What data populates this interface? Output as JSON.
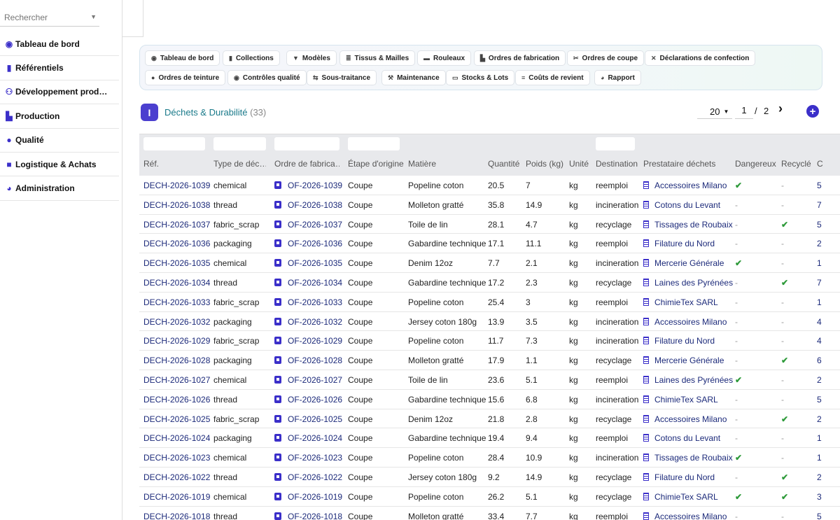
{
  "search": {
    "placeholder": "Rechercher"
  },
  "sidebar": {
    "items": [
      {
        "label": "Tableau de bord",
        "icon": "gauge-icon"
      },
      {
        "label": "Référentiels",
        "icon": "book-icon"
      },
      {
        "label": "Développement prod…",
        "icon": "people-icon"
      },
      {
        "label": "Production",
        "icon": "factory-icon"
      },
      {
        "label": "Qualité",
        "icon": "check-circle-icon"
      },
      {
        "label": "Logistique & Achats",
        "icon": "truck-icon"
      },
      {
        "label": "Administration",
        "icon": "pie-icon"
      }
    ]
  },
  "toolbar": {
    "row1": [
      {
        "label": "Tableau de bord",
        "icon": "gauge-icon"
      },
      {
        "label": "Collections",
        "icon": "book-icon"
      },
      {
        "label": "Modèles",
        "icon": "shirt-icon"
      },
      {
        "label": "Tissus & Mailles",
        "icon": "layers-icon"
      },
      {
        "label": "Rouleaux",
        "icon": "roll-icon"
      },
      {
        "label": "Ordres de fabrication",
        "icon": "factory-icon"
      },
      {
        "label": "Ordres de coupe",
        "icon": "scissors-icon"
      },
      {
        "label": "Déclarations de confection",
        "icon": "tools-icon"
      }
    ],
    "row2": [
      {
        "label": "Ordres de teinture",
        "icon": "drop-icon"
      },
      {
        "label": "Contrôles qualité",
        "icon": "check-circle-icon"
      },
      {
        "label": "Sous-traitance",
        "icon": "handshake-icon"
      },
      {
        "label": "Maintenance",
        "icon": "wrench-icon"
      },
      {
        "label": "Stocks & Lots",
        "icon": "warehouse-icon"
      },
      {
        "label": "Coûts de revient",
        "icon": "coins-icon"
      },
      {
        "label": "Rapport",
        "icon": "chart-pie-icon"
      }
    ]
  },
  "header": {
    "title": "Déchets & Durabilité",
    "count": "(33)",
    "page_size": "20",
    "page": "1",
    "page_sep": "/",
    "total_pages": "2"
  },
  "table": {
    "columns": [
      "Réf.",
      "Type de déc…",
      "Ordre de fabrica…",
      "Étape d'origine",
      "Matière",
      "Quantité",
      "Poids (kg)",
      "Unité",
      "Destination",
      "Prestataire déchets",
      "Dangereux",
      "Recyclé",
      "C"
    ],
    "rows": [
      {
        "ref": "DECH-2026-1039",
        "type": "chemical",
        "of": "OF-2026-1039",
        "etape": "Coupe",
        "matiere": "Popeline coton",
        "quantite": "20.5",
        "poids": "7",
        "unite": "kg",
        "destination": "reemploi",
        "prestataire": "Accessoires Milano",
        "dangereux": true,
        "recycle": false,
        "c": "5"
      },
      {
        "ref": "DECH-2026-1038",
        "type": "thread",
        "of": "OF-2026-1038",
        "etape": "Coupe",
        "matiere": "Molleton gratté",
        "quantite": "35.8",
        "poids": "14.9",
        "unite": "kg",
        "destination": "incineration",
        "prestataire": "Cotons du Levant",
        "dangereux": false,
        "recycle": false,
        "c": "7"
      },
      {
        "ref": "DECH-2026-1037",
        "type": "fabric_scrap",
        "of": "OF-2026-1037",
        "etape": "Coupe",
        "matiere": "Toile de lin",
        "quantite": "28.1",
        "poids": "4.7",
        "unite": "kg",
        "destination": "recyclage",
        "prestataire": "Tissages de Roubaix",
        "dangereux": false,
        "recycle": true,
        "c": "5"
      },
      {
        "ref": "DECH-2026-1036",
        "type": "packaging",
        "of": "OF-2026-1036",
        "etape": "Coupe",
        "matiere": "Gabardine technique",
        "quantite": "17.1",
        "poids": "11.1",
        "unite": "kg",
        "destination": "reemploi",
        "prestataire": "Filature du Nord",
        "dangereux": false,
        "recycle": false,
        "c": "2"
      },
      {
        "ref": "DECH-2026-1035",
        "type": "chemical",
        "of": "OF-2026-1035",
        "etape": "Coupe",
        "matiere": "Denim 12oz",
        "quantite": "7.7",
        "poids": "2.1",
        "unite": "kg",
        "destination": "incineration",
        "prestataire": "Mercerie Générale",
        "dangereux": true,
        "recycle": false,
        "c": "1"
      },
      {
        "ref": "DECH-2026-1034",
        "type": "thread",
        "of": "OF-2026-1034",
        "etape": "Coupe",
        "matiere": "Gabardine technique",
        "quantite": "17.2",
        "poids": "2.3",
        "unite": "kg",
        "destination": "recyclage",
        "prestataire": "Laines des Pyrénées",
        "dangereux": false,
        "recycle": true,
        "c": "7"
      },
      {
        "ref": "DECH-2026-1033",
        "type": "fabric_scrap",
        "of": "OF-2026-1033",
        "etape": "Coupe",
        "matiere": "Popeline coton",
        "quantite": "25.4",
        "poids": "3",
        "unite": "kg",
        "destination": "reemploi",
        "prestataire": "ChimieTex SARL",
        "dangereux": false,
        "recycle": false,
        "c": "1"
      },
      {
        "ref": "DECH-2026-1032",
        "type": "packaging",
        "of": "OF-2026-1032",
        "etape": "Coupe",
        "matiere": "Jersey coton 180g",
        "quantite": "13.9",
        "poids": "3.5",
        "unite": "kg",
        "destination": "incineration",
        "prestataire": "Accessoires Milano",
        "dangereux": false,
        "recycle": false,
        "c": "4"
      },
      {
        "ref": "DECH-2026-1029",
        "type": "fabric_scrap",
        "of": "OF-2026-1029",
        "etape": "Coupe",
        "matiere": "Popeline coton",
        "quantite": "11.7",
        "poids": "7.3",
        "unite": "kg",
        "destination": "incineration",
        "prestataire": "Filature du Nord",
        "dangereux": false,
        "recycle": false,
        "c": "4"
      },
      {
        "ref": "DECH-2026-1028",
        "type": "packaging",
        "of": "OF-2026-1028",
        "etape": "Coupe",
        "matiere": "Molleton gratté",
        "quantite": "17.9",
        "poids": "1.1",
        "unite": "kg",
        "destination": "recyclage",
        "prestataire": "Mercerie Générale",
        "dangereux": false,
        "recycle": true,
        "c": "6"
      },
      {
        "ref": "DECH-2026-1027",
        "type": "chemical",
        "of": "OF-2026-1027",
        "etape": "Coupe",
        "matiere": "Toile de lin",
        "quantite": "23.6",
        "poids": "5.1",
        "unite": "kg",
        "destination": "reemploi",
        "prestataire": "Laines des Pyrénées",
        "dangereux": true,
        "recycle": false,
        "c": "2"
      },
      {
        "ref": "DECH-2026-1026",
        "type": "thread",
        "of": "OF-2026-1026",
        "etape": "Coupe",
        "matiere": "Gabardine technique",
        "quantite": "15.6",
        "poids": "6.8",
        "unite": "kg",
        "destination": "incineration",
        "prestataire": "ChimieTex SARL",
        "dangereux": false,
        "recycle": false,
        "c": "5"
      },
      {
        "ref": "DECH-2026-1025",
        "type": "fabric_scrap",
        "of": "OF-2026-1025",
        "etape": "Coupe",
        "matiere": "Denim 12oz",
        "quantite": "21.8",
        "poids": "2.8",
        "unite": "kg",
        "destination": "recyclage",
        "prestataire": "Accessoires Milano",
        "dangereux": false,
        "recycle": true,
        "c": "2"
      },
      {
        "ref": "DECH-2026-1024",
        "type": "packaging",
        "of": "OF-2026-1024",
        "etape": "Coupe",
        "matiere": "Gabardine technique",
        "quantite": "19.4",
        "poids": "9.4",
        "unite": "kg",
        "destination": "reemploi",
        "prestataire": "Cotons du Levant",
        "dangereux": false,
        "recycle": false,
        "c": "1"
      },
      {
        "ref": "DECH-2026-1023",
        "type": "chemical",
        "of": "OF-2026-1023",
        "etape": "Coupe",
        "matiere": "Popeline coton",
        "quantite": "28.4",
        "poids": "10.9",
        "unite": "kg",
        "destination": "incineration",
        "prestataire": "Tissages de Roubaix",
        "dangereux": true,
        "recycle": false,
        "c": "1"
      },
      {
        "ref": "DECH-2026-1022",
        "type": "thread",
        "of": "OF-2026-1022",
        "etape": "Coupe",
        "matiere": "Jersey coton 180g",
        "quantite": "9.2",
        "poids": "14.9",
        "unite": "kg",
        "destination": "recyclage",
        "prestataire": "Filature du Nord",
        "dangereux": false,
        "recycle": true,
        "c": "2"
      },
      {
        "ref": "DECH-2026-1019",
        "type": "chemical",
        "of": "OF-2026-1019",
        "etape": "Coupe",
        "matiere": "Popeline coton",
        "quantite": "26.2",
        "poids": "5.1",
        "unite": "kg",
        "destination": "recyclage",
        "prestataire": "ChimieTex SARL",
        "dangereux": true,
        "recycle": true,
        "c": "3"
      },
      {
        "ref": "DECH-2026-1018",
        "type": "thread",
        "of": "OF-2026-1018",
        "etape": "Coupe",
        "matiere": "Molleton gratté",
        "quantite": "33.4",
        "poids": "7.7",
        "unite": "kg",
        "destination": "reemploi",
        "prestataire": "Accessoires Milano",
        "dangereux": false,
        "recycle": false,
        "c": "5"
      }
    ]
  },
  "symbols": {
    "check": "✔",
    "dash": "-"
  },
  "colors": {
    "accent": "#3b2fc9",
    "link": "#1c2a7a",
    "title": "#1a7a8a",
    "check": "#2e9a3a"
  }
}
